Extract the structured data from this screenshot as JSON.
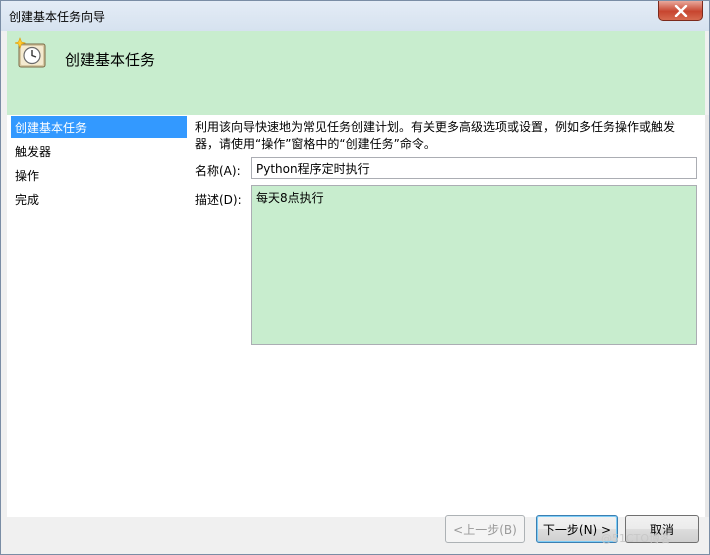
{
  "window": {
    "title": "创建基本任务向导"
  },
  "header": {
    "title": "创建基本任务"
  },
  "nav": {
    "items": [
      {
        "label": "创建基本任务",
        "selected": true
      },
      {
        "label": "触发器",
        "selected": false
      },
      {
        "label": "操作",
        "selected": false
      },
      {
        "label": "完成",
        "selected": false
      }
    ]
  },
  "form": {
    "description_line1": "利用该向导快速地为常见任务创建计划。有关更多高级选项或设置，例如多任务操作或触发",
    "description_line2": "器，请使用“操作”窗格中的“创建任务”命令。",
    "name_label": "名称(A):",
    "name_value": "Python程序定时执行",
    "desc_label": "描述(D):",
    "desc_value": "每天8点执行"
  },
  "buttons": {
    "back": "<上一步(B)",
    "next": "下一步(N) >",
    "cancel": "取消"
  },
  "watermark": "@51CTO博客",
  "colors": {
    "accent": "#c8edce",
    "selection": "#3399ff"
  }
}
